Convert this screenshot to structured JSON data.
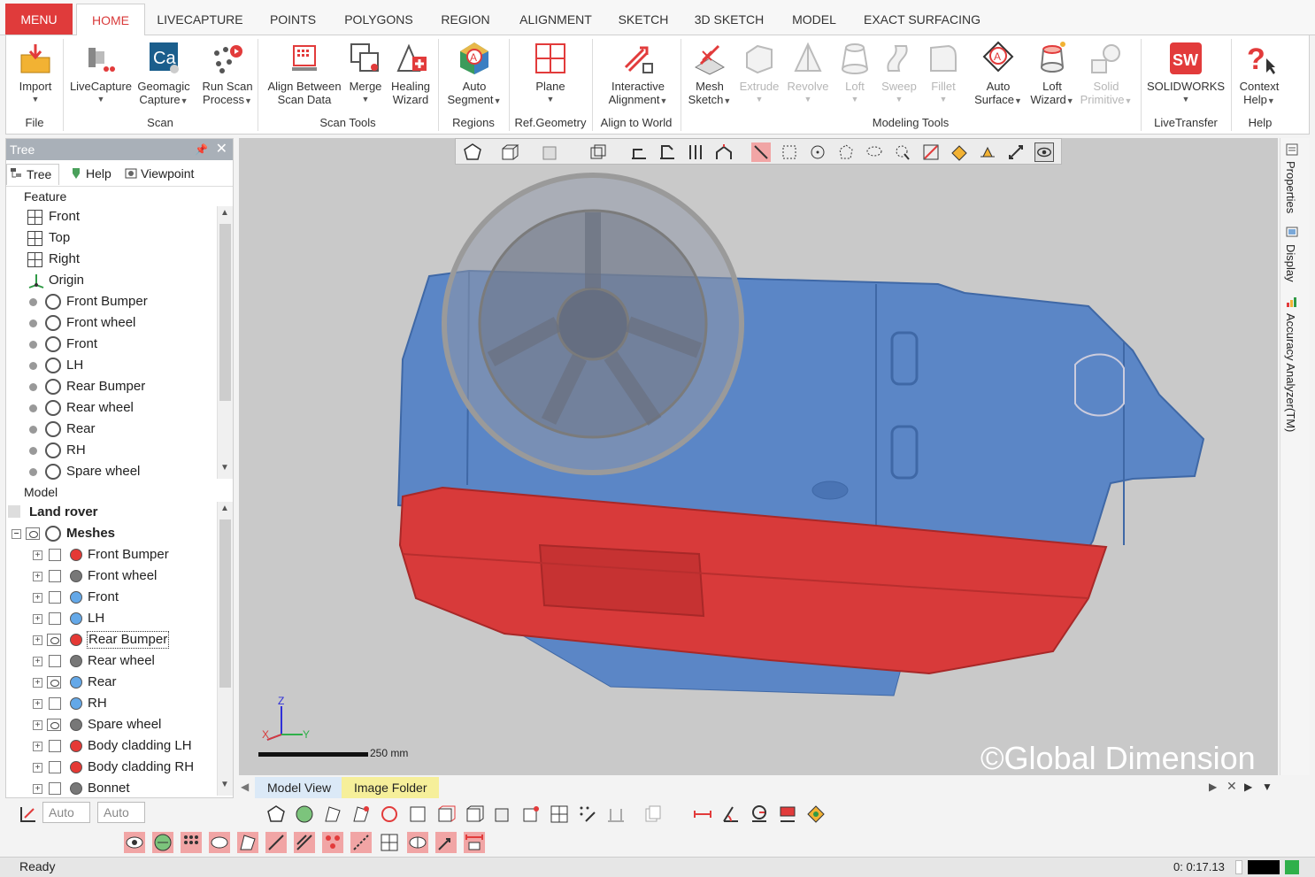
{
  "menu": {
    "button": "MENU",
    "tabs": [
      "HOME",
      "LIVECAPTURE",
      "POINTS",
      "POLYGONS",
      "REGION",
      "ALIGNMENT",
      "SKETCH",
      "3D SKETCH",
      "MODEL",
      "EXACT SURFACING"
    ],
    "active_tab": "HOME"
  },
  "ribbon": {
    "buttons": [
      {
        "l1": "Import",
        "l2": ""
      },
      {
        "l1": "LiveCapture",
        "l2": ""
      },
      {
        "l1": "Geomagic",
        "l2": "Capture"
      },
      {
        "l1": "Run Scan",
        "l2": "Process"
      },
      {
        "l1": "Align Between",
        "l2": "Scan Data"
      },
      {
        "l1": "Merge",
        "l2": ""
      },
      {
        "l1": "Healing",
        "l2": "Wizard"
      },
      {
        "l1": "Auto",
        "l2": "Segment"
      },
      {
        "l1": "Plane",
        "l2": ""
      },
      {
        "l1": "Interactive",
        "l2": "Alignment"
      },
      {
        "l1": "Mesh",
        "l2": "Sketch"
      },
      {
        "l1": "Extrude",
        "l2": ""
      },
      {
        "l1": "Revolve",
        "l2": ""
      },
      {
        "l1": "Loft",
        "l2": ""
      },
      {
        "l1": "Sweep",
        "l2": ""
      },
      {
        "l1": "Fillet",
        "l2": ""
      },
      {
        "l1": "Auto",
        "l2": "Surface"
      },
      {
        "l1": "Loft",
        "l2": "Wizard"
      },
      {
        "l1": "Solid",
        "l2": "Primitive"
      },
      {
        "l1": "SOLIDWORKS",
        "l2": ""
      },
      {
        "l1": "Context",
        "l2": "Help"
      }
    ],
    "groups": [
      "File",
      "Scan",
      "Scan Tools",
      "Regions",
      "Ref.Geometry",
      "Align to World",
      "Modeling Tools",
      "LiveTransfer",
      "Help"
    ],
    "geomagic_badge": "Ca"
  },
  "tree_panel": {
    "title": "Tree",
    "tabs": [
      "Tree",
      "Help",
      "Viewpoint"
    ],
    "feature_label": "Feature",
    "features": [
      "Front",
      "Top",
      "Right",
      "Origin",
      "Front Bumper",
      "Front wheel",
      "Front",
      "LH",
      "Rear Bumper",
      "Rear wheel",
      "Rear",
      "RH",
      "Spare wheel"
    ],
    "model_label": "Model",
    "root": "Land rover",
    "meshes_label": "Meshes",
    "meshes": [
      {
        "name": "Front Bumper",
        "color": "#e53935",
        "visible": false
      },
      {
        "name": "Front wheel",
        "color": "#777777",
        "visible": false
      },
      {
        "name": "Front",
        "color": "#64a8e8",
        "visible": false
      },
      {
        "name": "LH",
        "color": "#64a8e8",
        "visible": false
      },
      {
        "name": "Rear Bumper",
        "color": "#e53935",
        "visible": true
      },
      {
        "name": "Rear wheel",
        "color": "#777777",
        "visible": false
      },
      {
        "name": "Rear",
        "color": "#64a8e8",
        "visible": true
      },
      {
        "name": "RH",
        "color": "#64a8e8",
        "visible": false
      },
      {
        "name": "Spare wheel",
        "color": "#777777",
        "visible": true
      },
      {
        "name": "Body cladding LH",
        "color": "#e53935",
        "visible": false
      },
      {
        "name": "Body cladding RH",
        "color": "#e53935",
        "visible": false
      },
      {
        "name": "Bonnet",
        "color": "#777777",
        "visible": false
      }
    ]
  },
  "viewport": {
    "scale_label": "250 mm",
    "watermark": "©Global Dimension",
    "axis": {
      "x": "X",
      "y": "Y",
      "z": "Z"
    },
    "body_color": "#5b86c6",
    "bumper_color": "#d83a3a"
  },
  "right_dock": {
    "tabs": [
      "Properties",
      "Display",
      "Accuracy Analyzer(TM)"
    ]
  },
  "view_tabs": [
    "Model View",
    "Image Folder"
  ],
  "bottom": {
    "combo1": "Auto",
    "combo2": "Auto"
  },
  "status": {
    "text": "Ready",
    "timer": "0: 0:17.13"
  }
}
